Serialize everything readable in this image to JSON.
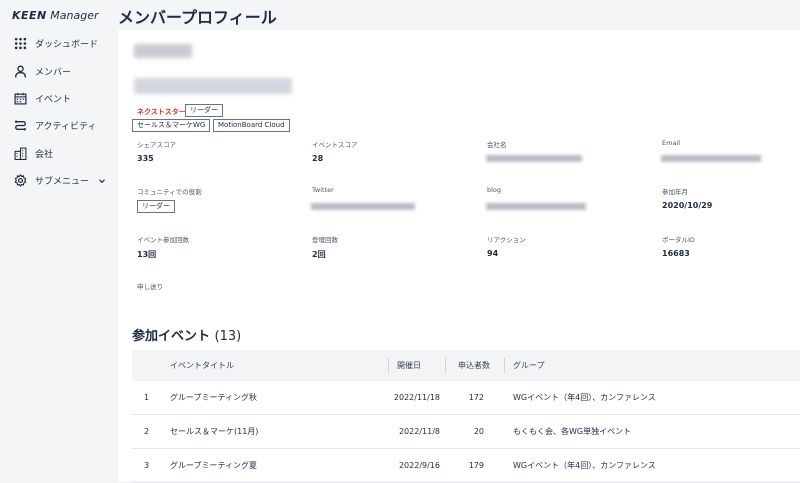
{
  "app": {
    "logo_main": "KEEN",
    "logo_sub": " Manager"
  },
  "sidebar": {
    "items": [
      {
        "label": "ダッシュボード",
        "icon": "grid-icon"
      },
      {
        "label": "メンバー",
        "icon": "user-icon"
      },
      {
        "label": "イベント",
        "icon": "calendar-icon"
      },
      {
        "label": "アクティビティ",
        "icon": "activity-icon"
      },
      {
        "label": "会社",
        "icon": "building-icon"
      },
      {
        "label": "サブメニュー",
        "icon": "gear-icon"
      }
    ]
  },
  "page": {
    "title": "メンバープロフィール"
  },
  "profile": {
    "tags": {
      "star": "ネクストスター",
      "leader": "リーダー",
      "wg": "セールス＆マーケWG",
      "motionboard": "MotionBoard Cloud"
    },
    "fields": {
      "share_score_label": "シェアスコア",
      "share_score": "335",
      "event_score_label": "イベントスコア",
      "event_score": "28",
      "company_label": "会社名",
      "email_label": "Email",
      "community_role_label": "コミュニティでの役割",
      "community_role": "リーダー",
      "twitter_label": "Twitter",
      "blog_label": "blog",
      "joined_label": "参加年月",
      "joined": "2020/10/29",
      "event_count_label": "イベント参加回数",
      "event_count": "13回",
      "stage_count_label": "登壇回数",
      "stage_count": "2回",
      "reaction_label": "リアクション",
      "reaction": "94",
      "portal_id_label": "ポータルID",
      "portal_id": "16683",
      "notes_label": "申し送り"
    }
  },
  "events": {
    "title": "参加イベント",
    "count": "(13)",
    "columns": {
      "title": "イベントタイトル",
      "date": "開催日",
      "applicants": "申込者数",
      "group": "グループ"
    },
    "rows": [
      {
        "no": "1",
        "title": "グループミーティング秋",
        "date": "2022/11/18",
        "applicants": "172",
        "group": "WGイベント（年4回）、カンファレンス"
      },
      {
        "no": "2",
        "title": "セールス＆マーケ(11月)",
        "date": "2022/11/8",
        "applicants": "20",
        "group": "もくもく会、各WG単独イベント"
      },
      {
        "no": "3",
        "title": "グループミーティング夏",
        "date": "2022/9/16",
        "applicants": "179",
        "group": "WGイベント（年4回）、カンファレンス"
      }
    ]
  },
  "colors": {
    "accent": "#1f2a44",
    "star_tag": "#d93025",
    "background": "#f4f5f7"
  }
}
